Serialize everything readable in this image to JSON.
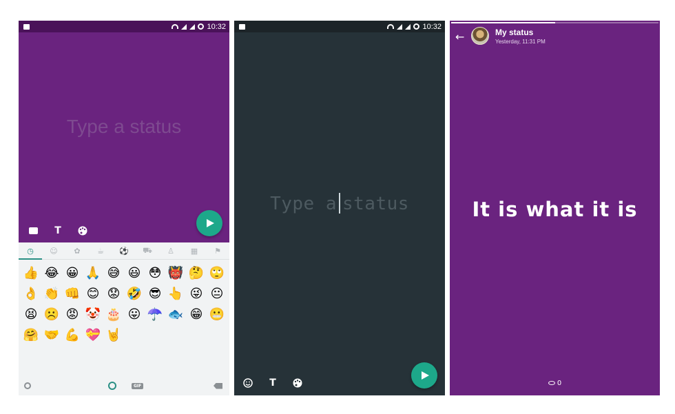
{
  "statusbar": {
    "time": "10:32"
  },
  "compose_text": {
    "placeholder": "Type a status",
    "placeholder_part1": "Type a",
    "placeholder_part2": "status",
    "tool_text_label": "T"
  },
  "emoji_keyboard": {
    "categories": [
      "recent-icon",
      "smileys-icon",
      "animals-icon",
      "food-icon",
      "activity-icon",
      "travel-icon",
      "objects-icon",
      "symbols-icon",
      "flags-icon"
    ],
    "emojis": [
      "👍",
      "😂",
      "😀",
      "🙏",
      "😅",
      "😃",
      "😳",
      "👹",
      "🤔",
      "🙄",
      "👌",
      "👏",
      "👊",
      "😊",
      "😟",
      "🤣",
      "😎",
      "👆",
      "😜",
      "😐",
      "😫",
      "☹️",
      "😡",
      "🤡",
      "🎂",
      "😛",
      "☂️",
      "🐟",
      "😁",
      "😬",
      "🤗",
      "🤝",
      "💪",
      "💝",
      "🤘"
    ],
    "gif_label": "GIF"
  },
  "status_view": {
    "name": "My status",
    "time": "Yesterday, 11:31 PM",
    "text": "It is what it is",
    "views": "0",
    "progress": 0.5
  }
}
